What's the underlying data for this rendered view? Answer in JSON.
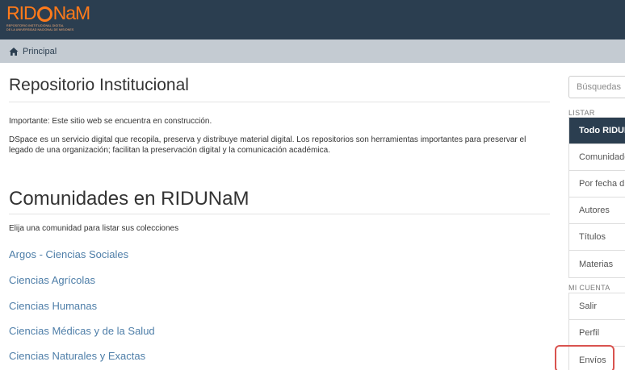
{
  "header": {
    "logo_text_left": "RID",
    "logo_text_right": "NaM",
    "logo_subtitle_1": "REPOSITORIO INSTITUCIONAL DIGITAL",
    "logo_subtitle_2": "DE LA UNIVERSIDAD NACIONAL DE MISIONES"
  },
  "breadcrumb": {
    "home_icon": "home-icon",
    "label": "Principal"
  },
  "main": {
    "title": "Repositorio Institucional",
    "note": "Importante: Este sitio web se encuentra en construcción.",
    "description": "DSpace es un servicio digital que recopila, preserva y distribuye material digital. Los repositorios son herramientas importantes para preservar el legado de una organización; facilitan la preservación digital y la comunicación académica.",
    "communities_title": "Comunidades en RIDUNaM",
    "communities_hint": "Elija una comunidad para listar sus colecciones",
    "communities": [
      "Argos - Ciencias Sociales",
      "Ciencias Agrícolas",
      "Ciencias Humanas",
      "Ciencias Médicas y de la Salud",
      "Ciencias Naturales y Exactas"
    ]
  },
  "sidebar": {
    "search_placeholder": "Búsquedas",
    "listar_label": "LISTAR",
    "listar_items": [
      "Todo RIDUN",
      "Comunidade",
      "Por fecha d",
      "Autores",
      "Títulos",
      "Materias"
    ],
    "cuenta_label": "MI CUENTA",
    "cuenta_items": [
      "Salir",
      "Perfil",
      "Envíos"
    ]
  },
  "colors": {
    "header_bg": "#2b3e50",
    "breadcrumb_bg": "#c4cbd2",
    "logo_orange": "#ff7a1a",
    "link_blue": "#4e7ea8",
    "highlight_red": "#d9534f"
  }
}
